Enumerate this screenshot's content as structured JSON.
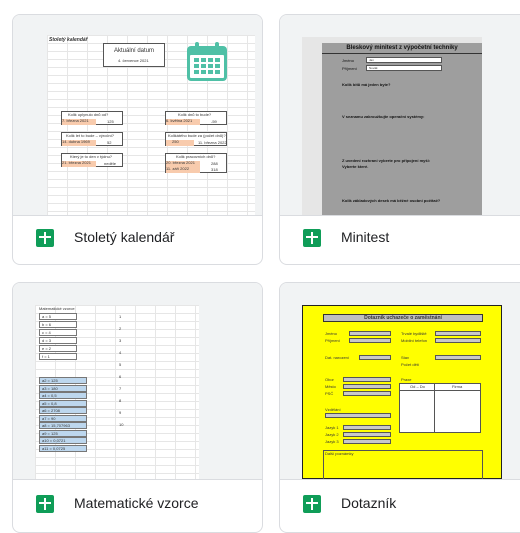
{
  "templates": [
    {
      "title": "Stoletý kalendář",
      "thumb": {
        "heading": "Stoletý kalendář",
        "date_label": "Aktuální datum",
        "date_value": "4. července 2021",
        "q1": "Kolik uplynulo dnů od?",
        "q1_date": "7. března 2021",
        "q1_value": "125",
        "q2": "Kolik dnů to bude?",
        "q2_date": "6. května 2021",
        "q2_value": "-59",
        "q3": "Kolik let to bude – výroční?",
        "q3_date": "14. dubna 1969",
        "q3_value": "52",
        "q4": "Kolikátého bude za (počet dnů)?",
        "q4_days": "250",
        "q4_value": "11. března 2022",
        "q5": "Který je to den v týdnu?",
        "q5_date": "21. března 2021",
        "q5_value": "neděle",
        "q6": "Kolik pracovních dnů?",
        "q6_date_a": "20. března 2021",
        "q6_date_b": "11. září 2022",
        "q6_value_a": "288",
        "q6_value_b": "318"
      }
    },
    {
      "title": "Minitest",
      "thumb": {
        "heading": "Bleskový minitest z výpočetní techniky",
        "name_label": "Jméno",
        "name_value": "Jan",
        "surname_label": "Příjmení",
        "surname_value": "Novák",
        "q1": "Kolik bitů má jeden byte?",
        "q2": "V seznamu zakroužkujte operační systémy:",
        "q3": "Z uvedení rozhraní vyberte pro připojení myši:",
        "q3_extra": "Vyberte které.",
        "q4": "Kolik základových desek má běžné osobní počítač?"
      }
    },
    {
      "title": "Matematické vzorce",
      "thumb": {
        "heading": "Matematické vzorce",
        "vars": [
          "a = 5",
          "b = 6",
          "c = 4",
          "d = 3",
          "e = 2",
          "f = 1"
        ],
        "results": [
          "a2 = 125",
          "a3 = 180",
          "a4 = 0,5",
          "a5 = 0,8",
          "a6 = 2708",
          "a7 = 90",
          "a8 = 15,707963",
          "a9 = 125",
          "a10 = 0,0721",
          "a11 = 0,0725"
        ],
        "numbers": [
          "1",
          "2",
          "3",
          "4",
          "5",
          "6",
          "7",
          "8",
          "9",
          "10"
        ]
      }
    },
    {
      "title": "Dotazník",
      "thumb": {
        "heading": "Dotazník uchazeče o zaměstnání",
        "f1": "Jméno",
        "f2": "Příjmení",
        "f3": "Trvalé bydliště",
        "f4": "Mobilní telefon",
        "f5": "Dat. narození",
        "f6": "Stav",
        "f7": "Počet dětí",
        "f8": "Obor",
        "f9": "Město",
        "f10": "PSČ",
        "f11": "Praxe",
        "f12": "Vzdělání",
        "f13": "Jazyk 1",
        "f14": "Jazyk 2",
        "f15": "Jazyk 3",
        "f16": "Další poznámky",
        "col1": "Od – Do",
        "col2": "Firma"
      }
    }
  ],
  "colors": {
    "sheets_green": "#0f9d58",
    "border": "#dadce0",
    "calendar_teal": "#4fc0a6",
    "yellow": "#ffff00",
    "peach": "#f8cbad",
    "blue_cells": "#bdd7ee"
  }
}
